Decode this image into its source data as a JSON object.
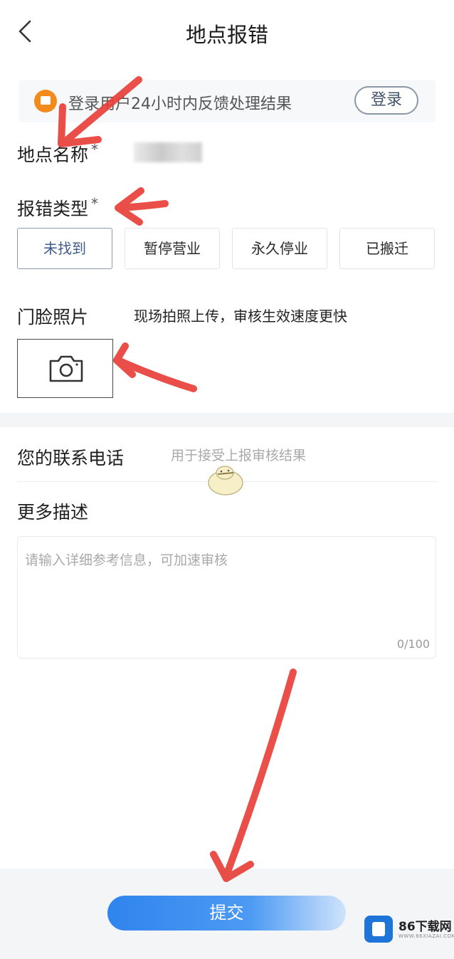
{
  "header": {
    "title": "地点报错",
    "back_icon": "chevron-left-icon"
  },
  "notice": {
    "text": "登录用户24小时内反馈处理结果",
    "login_label": "登录",
    "icon": "megaphone-icon",
    "icon_color": "#f28a1c"
  },
  "place": {
    "label": "地点名称",
    "required_mark": "*"
  },
  "report_type": {
    "label": "报错类型",
    "required_mark": "*",
    "options": [
      "未找到",
      "暂停营业",
      "永久停业",
      "已搬迁"
    ],
    "selected": "未找到"
  },
  "photo": {
    "label": "门脸照片",
    "hint": "现场拍照上传，审核生效速度更快",
    "icon": "camera-icon"
  },
  "contact": {
    "label": "您的联系电话",
    "placeholder": "用于接受上报审核结果"
  },
  "description": {
    "label": "更多描述",
    "placeholder": "请输入详细参考信息，可加速审核",
    "counter": "0/100"
  },
  "submit": {
    "label": "提交",
    "color": "#2f84ee"
  },
  "watermark": {
    "title": "86下载网",
    "subtitle": "WWW.86XIAZAI.COM"
  },
  "annotation_color": "#e8403a"
}
